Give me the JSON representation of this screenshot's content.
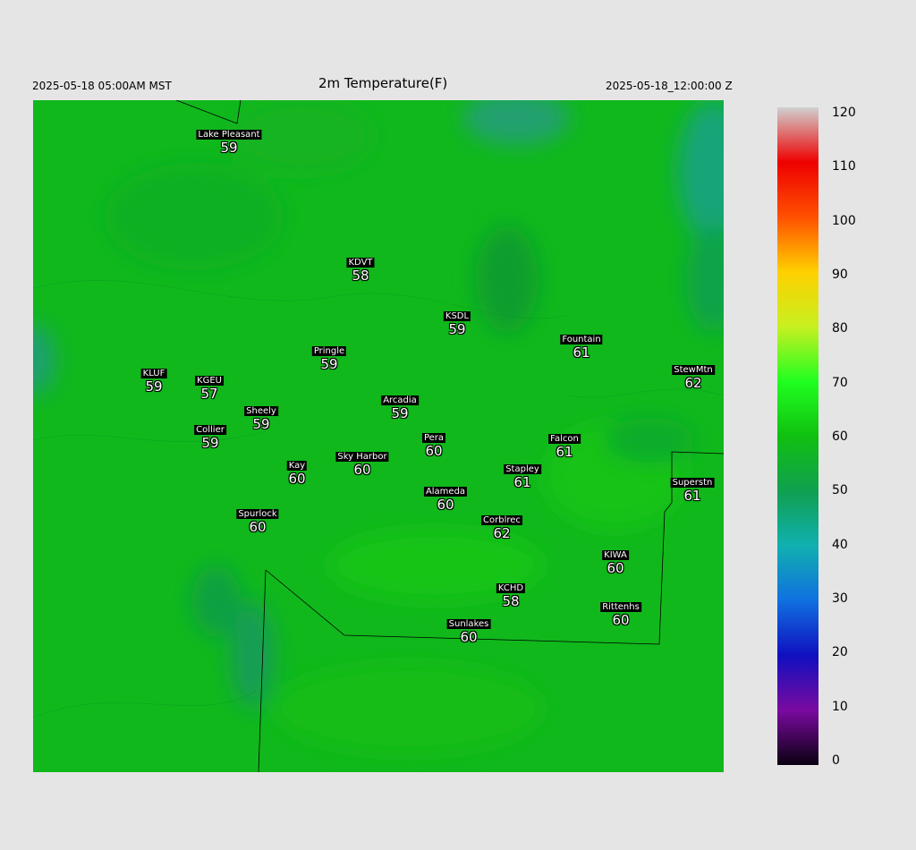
{
  "header": {
    "local_time": "2025-05-18 05:00AM MST",
    "title": "2m Temperature(F)",
    "utc_time": "2025-05-18_12:00:00 Z"
  },
  "stations": [
    {
      "name": "Lake Pleasant",
      "value": "59"
    },
    {
      "name": "KDVT",
      "value": "58"
    },
    {
      "name": "KSDL",
      "value": "59"
    },
    {
      "name": "Fountain",
      "value": "61"
    },
    {
      "name": "Pringle",
      "value": "59"
    },
    {
      "name": "KLUF",
      "value": "59"
    },
    {
      "name": "KGEU",
      "value": "57"
    },
    {
      "name": "StewMtn",
      "value": "62"
    },
    {
      "name": "Arcadia",
      "value": "59"
    },
    {
      "name": "Sheely",
      "value": "59"
    },
    {
      "name": "Collier",
      "value": "59"
    },
    {
      "name": "Pera",
      "value": "60"
    },
    {
      "name": "Falcon",
      "value": "61"
    },
    {
      "name": "Kay",
      "value": "60"
    },
    {
      "name": "Sky Harbor",
      "value": "60"
    },
    {
      "name": "Stapley",
      "value": "61"
    },
    {
      "name": "Superstn",
      "value": "61"
    },
    {
      "name": "Alameda",
      "value": "60"
    },
    {
      "name": "Spurlock",
      "value": "60"
    },
    {
      "name": "Corblrec",
      "value": "62"
    },
    {
      "name": "KIWA",
      "value": "60"
    },
    {
      "name": "KCHD",
      "value": "58"
    },
    {
      "name": "Rittenhs",
      "value": "60"
    },
    {
      "name": "Sunlakes",
      "value": "60"
    }
  ],
  "colorbar": {
    "min": 0,
    "max": 120,
    "ticks": [
      "120",
      "110",
      "100",
      "90",
      "80",
      "70",
      "60",
      "50",
      "40",
      "30",
      "20",
      "10",
      "0"
    ],
    "colors": {
      "c0": "#0a0010",
      "c10": "#7a0aa0",
      "c20": "#1010c0",
      "c30": "#1070e0",
      "c40": "#10b0b0",
      "c50": "#10a050",
      "c60": "#10c010",
      "c70": "#20ff20",
      "c80": "#c8f020",
      "c90": "#ffd000",
      "c100": "#ff5000",
      "c110": "#ee0000",
      "c120": "#d0d0d0"
    }
  }
}
